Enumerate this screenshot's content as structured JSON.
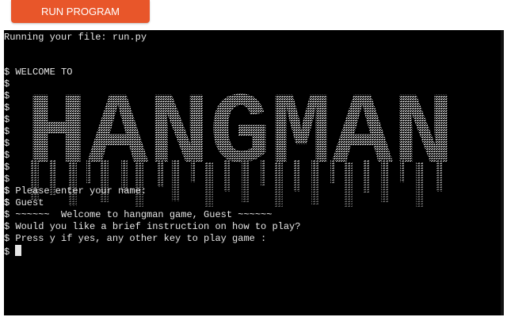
{
  "toolbar": {
    "run_label": "RUN PROGRAM"
  },
  "terminal": {
    "header": "Running your file: run.py",
    "prompt": "$",
    "welcome_line": "$ WELCOME TO",
    "banner_text": "HANGMAN",
    "name_prompt": "$ Please enter your name:",
    "name_input": "$ Guest",
    "greeting": "$ ~~~~~~  Welcome to hangman game, Guest ~~~~~~",
    "instruction_question": "$ Would you like a brief instruction on how to play?",
    "instruction_choice": "$ Press y if yes, any other key to play game :",
    "cursor_prompt": "$ ",
    "colors": {
      "background": "#000000",
      "text": "#e6e6e6",
      "button": "#e8562a"
    }
  }
}
